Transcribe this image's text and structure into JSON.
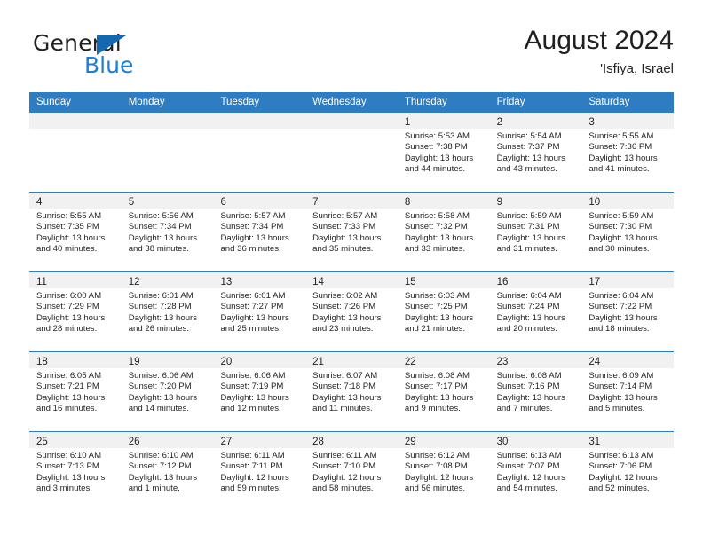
{
  "brand": {
    "name_part1": "General",
    "name_part2": "Blue",
    "triangle_icon": "blue-triangle-icon",
    "color_dark": "#231f20",
    "color_blue": "#1a7fd4"
  },
  "header": {
    "title": "August 2024",
    "subtitle": "'Isfiya, Israel"
  },
  "theme": {
    "header_bg": "#2e7cc1",
    "day_band_bg": "#f1f1f1",
    "cell_bg": "#ffffff",
    "text": "#231f20"
  },
  "weekdays": [
    "Sunday",
    "Monday",
    "Tuesday",
    "Wednesday",
    "Thursday",
    "Friday",
    "Saturday"
  ],
  "weeks": [
    [
      {
        "day": "",
        "l1": "",
        "l2": "",
        "l3": "",
        "l4": ""
      },
      {
        "day": "",
        "l1": "",
        "l2": "",
        "l3": "",
        "l4": ""
      },
      {
        "day": "",
        "l1": "",
        "l2": "",
        "l3": "",
        "l4": ""
      },
      {
        "day": "",
        "l1": "",
        "l2": "",
        "l3": "",
        "l4": ""
      },
      {
        "day": "1",
        "l1": "Sunrise: 5:53 AM",
        "l2": "Sunset: 7:38 PM",
        "l3": "Daylight: 13 hours",
        "l4": "and 44 minutes."
      },
      {
        "day": "2",
        "l1": "Sunrise: 5:54 AM",
        "l2": "Sunset: 7:37 PM",
        "l3": "Daylight: 13 hours",
        "l4": "and 43 minutes."
      },
      {
        "day": "3",
        "l1": "Sunrise: 5:55 AM",
        "l2": "Sunset: 7:36 PM",
        "l3": "Daylight: 13 hours",
        "l4": "and 41 minutes."
      }
    ],
    [
      {
        "day": "4",
        "l1": "Sunrise: 5:55 AM",
        "l2": "Sunset: 7:35 PM",
        "l3": "Daylight: 13 hours",
        "l4": "and 40 minutes."
      },
      {
        "day": "5",
        "l1": "Sunrise: 5:56 AM",
        "l2": "Sunset: 7:34 PM",
        "l3": "Daylight: 13 hours",
        "l4": "and 38 minutes."
      },
      {
        "day": "6",
        "l1": "Sunrise: 5:57 AM",
        "l2": "Sunset: 7:34 PM",
        "l3": "Daylight: 13 hours",
        "l4": "and 36 minutes."
      },
      {
        "day": "7",
        "l1": "Sunrise: 5:57 AM",
        "l2": "Sunset: 7:33 PM",
        "l3": "Daylight: 13 hours",
        "l4": "and 35 minutes."
      },
      {
        "day": "8",
        "l1": "Sunrise: 5:58 AM",
        "l2": "Sunset: 7:32 PM",
        "l3": "Daylight: 13 hours",
        "l4": "and 33 minutes."
      },
      {
        "day": "9",
        "l1": "Sunrise: 5:59 AM",
        "l2": "Sunset: 7:31 PM",
        "l3": "Daylight: 13 hours",
        "l4": "and 31 minutes."
      },
      {
        "day": "10",
        "l1": "Sunrise: 5:59 AM",
        "l2": "Sunset: 7:30 PM",
        "l3": "Daylight: 13 hours",
        "l4": "and 30 minutes."
      }
    ],
    [
      {
        "day": "11",
        "l1": "Sunrise: 6:00 AM",
        "l2": "Sunset: 7:29 PM",
        "l3": "Daylight: 13 hours",
        "l4": "and 28 minutes."
      },
      {
        "day": "12",
        "l1": "Sunrise: 6:01 AM",
        "l2": "Sunset: 7:28 PM",
        "l3": "Daylight: 13 hours",
        "l4": "and 26 minutes."
      },
      {
        "day": "13",
        "l1": "Sunrise: 6:01 AM",
        "l2": "Sunset: 7:27 PM",
        "l3": "Daylight: 13 hours",
        "l4": "and 25 minutes."
      },
      {
        "day": "14",
        "l1": "Sunrise: 6:02 AM",
        "l2": "Sunset: 7:26 PM",
        "l3": "Daylight: 13 hours",
        "l4": "and 23 minutes."
      },
      {
        "day": "15",
        "l1": "Sunrise: 6:03 AM",
        "l2": "Sunset: 7:25 PM",
        "l3": "Daylight: 13 hours",
        "l4": "and 21 minutes."
      },
      {
        "day": "16",
        "l1": "Sunrise: 6:04 AM",
        "l2": "Sunset: 7:24 PM",
        "l3": "Daylight: 13 hours",
        "l4": "and 20 minutes."
      },
      {
        "day": "17",
        "l1": "Sunrise: 6:04 AM",
        "l2": "Sunset: 7:22 PM",
        "l3": "Daylight: 13 hours",
        "l4": "and 18 minutes."
      }
    ],
    [
      {
        "day": "18",
        "l1": "Sunrise: 6:05 AM",
        "l2": "Sunset: 7:21 PM",
        "l3": "Daylight: 13 hours",
        "l4": "and 16 minutes."
      },
      {
        "day": "19",
        "l1": "Sunrise: 6:06 AM",
        "l2": "Sunset: 7:20 PM",
        "l3": "Daylight: 13 hours",
        "l4": "and 14 minutes."
      },
      {
        "day": "20",
        "l1": "Sunrise: 6:06 AM",
        "l2": "Sunset: 7:19 PM",
        "l3": "Daylight: 13 hours",
        "l4": "and 12 minutes."
      },
      {
        "day": "21",
        "l1": "Sunrise: 6:07 AM",
        "l2": "Sunset: 7:18 PM",
        "l3": "Daylight: 13 hours",
        "l4": "and 11 minutes."
      },
      {
        "day": "22",
        "l1": "Sunrise: 6:08 AM",
        "l2": "Sunset: 7:17 PM",
        "l3": "Daylight: 13 hours",
        "l4": "and 9 minutes."
      },
      {
        "day": "23",
        "l1": "Sunrise: 6:08 AM",
        "l2": "Sunset: 7:16 PM",
        "l3": "Daylight: 13 hours",
        "l4": "and 7 minutes."
      },
      {
        "day": "24",
        "l1": "Sunrise: 6:09 AM",
        "l2": "Sunset: 7:14 PM",
        "l3": "Daylight: 13 hours",
        "l4": "and 5 minutes."
      }
    ],
    [
      {
        "day": "25",
        "l1": "Sunrise: 6:10 AM",
        "l2": "Sunset: 7:13 PM",
        "l3": "Daylight: 13 hours",
        "l4": "and 3 minutes."
      },
      {
        "day": "26",
        "l1": "Sunrise: 6:10 AM",
        "l2": "Sunset: 7:12 PM",
        "l3": "Daylight: 13 hours",
        "l4": "and 1 minute."
      },
      {
        "day": "27",
        "l1": "Sunrise: 6:11 AM",
        "l2": "Sunset: 7:11 PM",
        "l3": "Daylight: 12 hours",
        "l4": "and 59 minutes."
      },
      {
        "day": "28",
        "l1": "Sunrise: 6:11 AM",
        "l2": "Sunset: 7:10 PM",
        "l3": "Daylight: 12 hours",
        "l4": "and 58 minutes."
      },
      {
        "day": "29",
        "l1": "Sunrise: 6:12 AM",
        "l2": "Sunset: 7:08 PM",
        "l3": "Daylight: 12 hours",
        "l4": "and 56 minutes."
      },
      {
        "day": "30",
        "l1": "Sunrise: 6:13 AM",
        "l2": "Sunset: 7:07 PM",
        "l3": "Daylight: 12 hours",
        "l4": "and 54 minutes."
      },
      {
        "day": "31",
        "l1": "Sunrise: 6:13 AM",
        "l2": "Sunset: 7:06 PM",
        "l3": "Daylight: 12 hours",
        "l4": "and 52 minutes."
      }
    ]
  ]
}
